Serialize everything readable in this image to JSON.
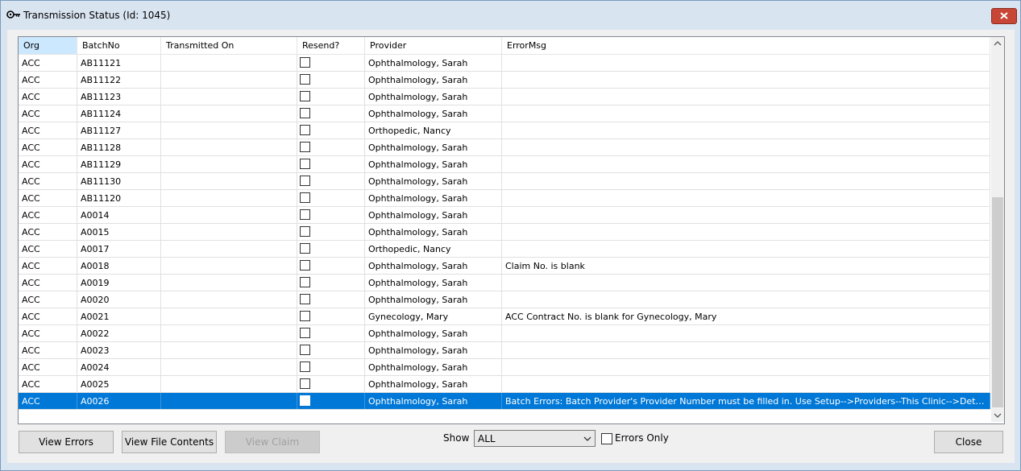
{
  "window": {
    "title": "Transmission Status (Id: 1045)"
  },
  "grid": {
    "columns": [
      "Org",
      "BatchNo",
      "Transmitted On",
      "Resend?",
      "Provider",
      "ErrorMsg"
    ],
    "rows": [
      {
        "org": "ACC",
        "batch": "AB11121",
        "transmitted": "",
        "resend": false,
        "provider": "Ophthalmology, Sarah",
        "error": ""
      },
      {
        "org": "ACC",
        "batch": "AB11122",
        "transmitted": "",
        "resend": false,
        "provider": "Ophthalmology, Sarah",
        "error": ""
      },
      {
        "org": "ACC",
        "batch": "AB11123",
        "transmitted": "",
        "resend": false,
        "provider": "Ophthalmology, Sarah",
        "error": ""
      },
      {
        "org": "ACC",
        "batch": "AB11124",
        "transmitted": "",
        "resend": false,
        "provider": "Ophthalmology, Sarah",
        "error": ""
      },
      {
        "org": "ACC",
        "batch": "AB11127",
        "transmitted": "",
        "resend": false,
        "provider": "Orthopedic, Nancy",
        "error": ""
      },
      {
        "org": "ACC",
        "batch": "AB11128",
        "transmitted": "",
        "resend": false,
        "provider": "Ophthalmology, Sarah",
        "error": ""
      },
      {
        "org": "ACC",
        "batch": "AB11129",
        "transmitted": "",
        "resend": false,
        "provider": "Ophthalmology, Sarah",
        "error": ""
      },
      {
        "org": "ACC",
        "batch": "AB11130",
        "transmitted": "",
        "resend": false,
        "provider": "Ophthalmology, Sarah",
        "error": ""
      },
      {
        "org": "ACC",
        "batch": "AB11120",
        "transmitted": "",
        "resend": false,
        "provider": "Ophthalmology, Sarah",
        "error": ""
      },
      {
        "org": "ACC",
        "batch": "A0014",
        "transmitted": "",
        "resend": false,
        "provider": "Ophthalmology, Sarah",
        "error": ""
      },
      {
        "org": "ACC",
        "batch": "A0015",
        "transmitted": "",
        "resend": false,
        "provider": "Ophthalmology, Sarah",
        "error": ""
      },
      {
        "org": "ACC",
        "batch": "A0017",
        "transmitted": "",
        "resend": false,
        "provider": "Orthopedic, Nancy",
        "error": ""
      },
      {
        "org": "ACC",
        "batch": "A0018",
        "transmitted": "",
        "resend": false,
        "provider": "Ophthalmology, Sarah",
        "error": "Claim No. is blank"
      },
      {
        "org": "ACC",
        "batch": "A0019",
        "transmitted": "",
        "resend": false,
        "provider": "Ophthalmology, Sarah",
        "error": ""
      },
      {
        "org": "ACC",
        "batch": "A0020",
        "transmitted": "",
        "resend": false,
        "provider": "Ophthalmology, Sarah",
        "error": ""
      },
      {
        "org": "ACC",
        "batch": "A0021",
        "transmitted": "",
        "resend": false,
        "provider": "Gynecology, Mary",
        "error": "ACC Contract No. is blank for Gynecology, Mary"
      },
      {
        "org": "ACC",
        "batch": "A0022",
        "transmitted": "",
        "resend": false,
        "provider": "Ophthalmology, Sarah",
        "error": ""
      },
      {
        "org": "ACC",
        "batch": "A0023",
        "transmitted": "",
        "resend": false,
        "provider": "Ophthalmology, Sarah",
        "error": ""
      },
      {
        "org": "ACC",
        "batch": "A0024",
        "transmitted": "",
        "resend": false,
        "provider": "Ophthalmology, Sarah",
        "error": ""
      },
      {
        "org": "ACC",
        "batch": "A0025",
        "transmitted": "",
        "resend": false,
        "provider": "Ophthalmology, Sarah",
        "error": ""
      },
      {
        "org": "ACC",
        "batch": "A0026",
        "transmitted": "",
        "resend": false,
        "provider": "Ophthalmology, Sarah",
        "error": "Batch Errors: Batch Provider's Provider Number must be filled in. Use Setup-->Providers--This Clinic-->Details Tab-->Numbers:...",
        "selected": true
      }
    ]
  },
  "footer": {
    "view_errors": "View Errors",
    "view_file_contents": "View File Contents",
    "view_claim": "View Claim",
    "show_label": "Show",
    "show_value": "ALL",
    "errors_only": "Errors Only",
    "errors_only_checked": false,
    "close": "Close"
  },
  "colors": {
    "selection": "#0078d7",
    "header_selected": "#cce8ff",
    "title_close": "#c74635"
  },
  "icons": {
    "window": "key-icon",
    "close": "close-icon",
    "scroll_up": "chevron-up-icon",
    "scroll_down": "chevron-down-icon",
    "dropdown": "chevron-down-icon"
  }
}
